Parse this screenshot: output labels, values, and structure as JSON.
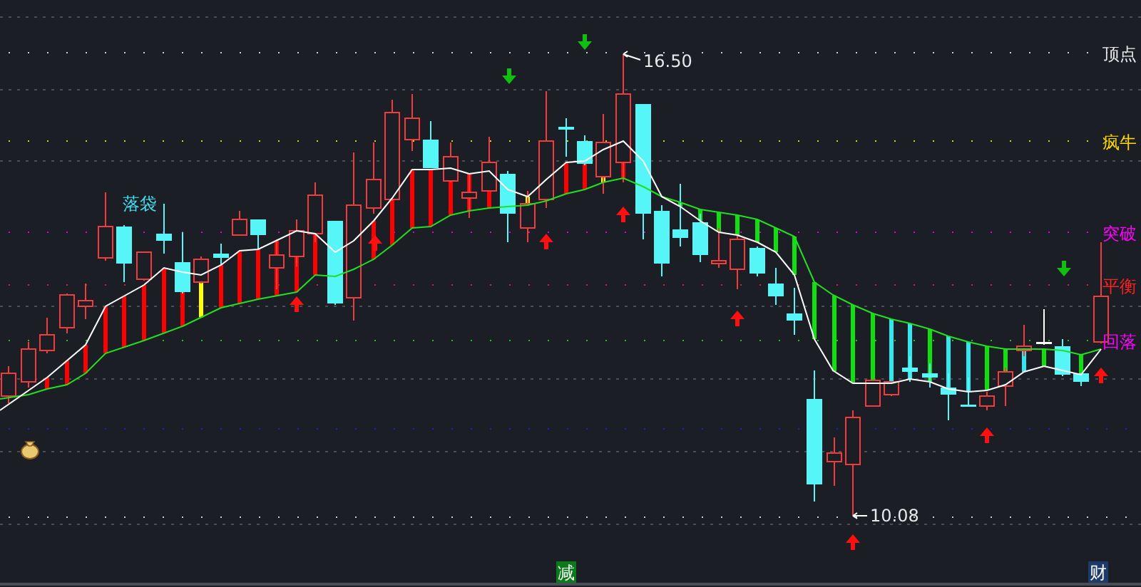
{
  "price_labels": [
    {
      "kind": "high",
      "text": "16.50"
    },
    {
      "kind": "low",
      "text": "10.08"
    }
  ],
  "signal_label": {
    "text": "落袋"
  },
  "level_labels": [
    {
      "text": "顶点",
      "color": "#e8e8e8"
    },
    {
      "text": "疯牛",
      "color": "#ffd800"
    },
    {
      "text": "突破",
      "color": "#ff00ff"
    },
    {
      "text": "平衡",
      "color": "#ff2020"
    },
    {
      "text": "回落",
      "color": "#ff00ff"
    }
  ],
  "bottom_markers": [
    {
      "text": "减",
      "color": "#0a7a1a"
    },
    {
      "text": "财",
      "color": "#1c3a6a"
    }
  ]
}
